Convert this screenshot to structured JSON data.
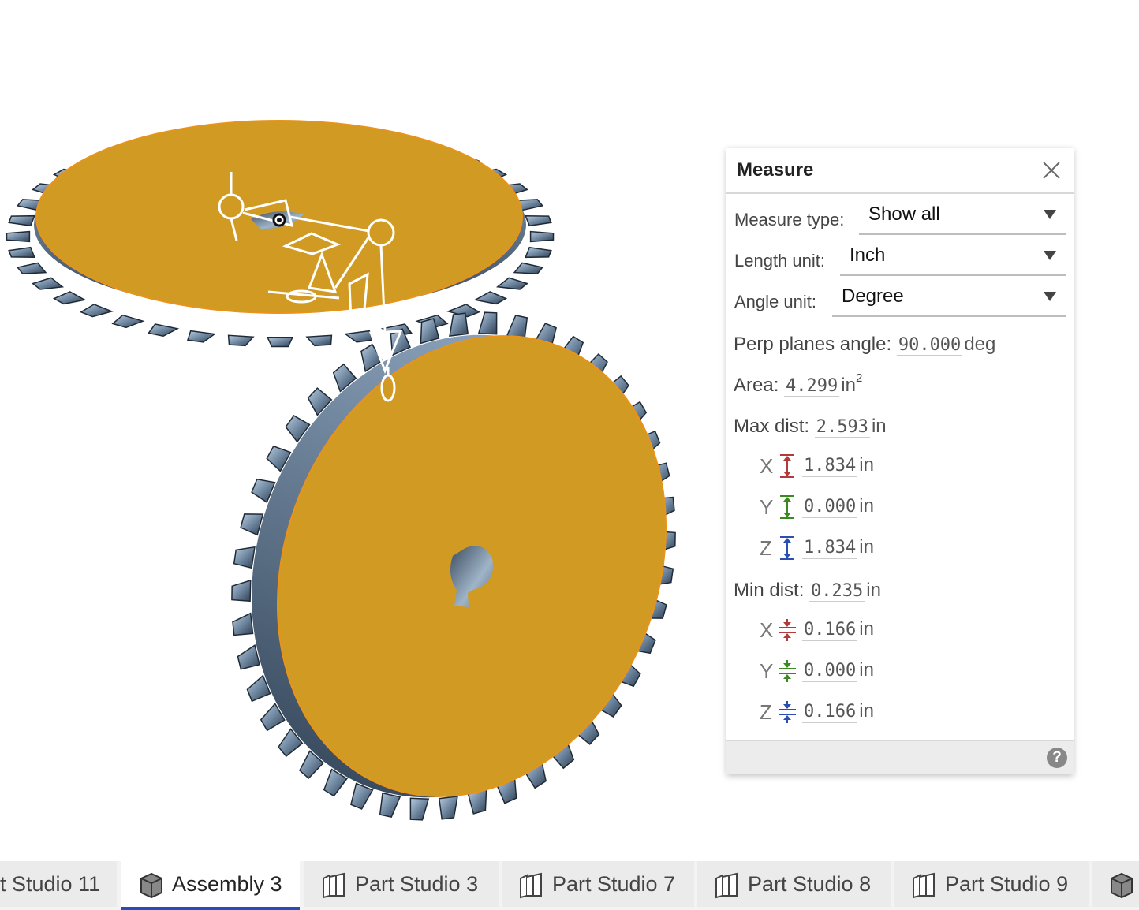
{
  "measure": {
    "title": "Measure",
    "measure_type_label": "Measure type:",
    "measure_type_value": "Show all",
    "length_unit_label": "Length unit:",
    "length_unit_value": "Inch",
    "angle_unit_label": "Angle unit:",
    "angle_unit_value": "Degree",
    "perp_label": "Perp planes angle:",
    "perp_value": "90.000",
    "perp_unit": "deg",
    "area_label": "Area:",
    "area_value": "4.299",
    "area_unit": "in",
    "area_exp": "2",
    "max_label": "Max dist:",
    "max_value": "2.593",
    "max_unit": "in",
    "max_components": [
      {
        "axis": "X",
        "value": "1.834",
        "unit": "in",
        "color": "#b23a3a"
      },
      {
        "axis": "Y",
        "value": "0.000",
        "unit": "in",
        "color": "#3a8a1f"
      },
      {
        "axis": "Z",
        "value": "1.834",
        "unit": "in",
        "color": "#2b4fb0"
      }
    ],
    "min_label": "Min dist:",
    "min_value": "0.235",
    "min_unit": "in",
    "min_components": [
      {
        "axis": "X",
        "value": "0.166",
        "unit": "in",
        "color": "#b23a3a"
      },
      {
        "axis": "Y",
        "value": "0.000",
        "unit": "in",
        "color": "#3a8a1f"
      },
      {
        "axis": "Z",
        "value": "0.166",
        "unit": "in",
        "color": "#2b4fb0"
      }
    ],
    "help": "?"
  },
  "colors": {
    "gear_face": "#d19a22",
    "gear_edge": "#e8931a",
    "gear_teeth": "#7f97b0",
    "tab_active_underline": "#2b4bb5"
  },
  "tabs": [
    {
      "label": "t Studio 11",
      "icon": "part-studio-icon"
    },
    {
      "label": "Assembly 3",
      "icon": "assembly-icon",
      "active": true
    },
    {
      "label": "Part Studio 3",
      "icon": "part-studio-icon"
    },
    {
      "label": "Part Studio 7",
      "icon": "part-studio-icon"
    },
    {
      "label": "Part Studio 8",
      "icon": "part-studio-icon"
    },
    {
      "label": "Part Studio 9",
      "icon": "part-studio-icon"
    },
    {
      "label": "",
      "icon": "assembly-icon"
    }
  ]
}
